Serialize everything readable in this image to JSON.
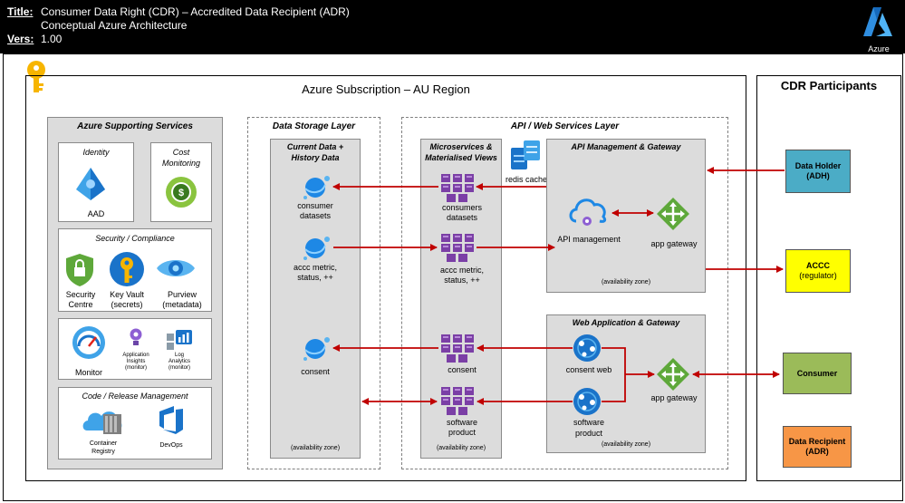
{
  "header": {
    "title_key": "Title:",
    "title_line1": "Consumer Data Right (CDR) – Accredited Data Recipient (ADR)",
    "title_line2": "Conceptual Azure Architecture",
    "vers_key": "Vers:",
    "version": "1.00",
    "logo_label": "Azure"
  },
  "subscription": {
    "title": "Azure Subscription – AU Region"
  },
  "participants": {
    "title": "CDR Participants",
    "data_holder": {
      "name": "Data Holder",
      "sub": "(ADH)",
      "color": "#4bacc6"
    },
    "accc": {
      "name": "ACCC",
      "sub": "(regulator)",
      "color": "#ffff00"
    },
    "consumer": {
      "name": "Consumer",
      "color": "#9bbb59"
    },
    "data_recipient": {
      "name": "Data Recipient",
      "sub": "(ADR)",
      "color": "#f79646"
    }
  },
  "supporting": {
    "title": "Azure Supporting Services",
    "identity": {
      "title": "Identity",
      "aad": "AAD"
    },
    "cost": {
      "title_line1": "Cost",
      "title_line2": "Monitoring"
    },
    "security": {
      "title": "Security / Compliance",
      "sec_centre_1": "Security",
      "sec_centre_2": "Centre",
      "keyvault_1": "Key Vault",
      "keyvault_2": "(secrets)",
      "purview_1": "Purview",
      "purview_2": "(metadata)"
    },
    "monitoring": {
      "monitor": "Monitor",
      "app_insights_1": "Application",
      "app_insights_2": "Insights",
      "app_insights_3": "(monitor)",
      "log_1": "Log",
      "log_2": "Analytics",
      "log_3": "(monitor)"
    },
    "code": {
      "title": "Code / Release Management",
      "registry_1": "Container",
      "registry_2": "Registry",
      "devops": "DevOps"
    }
  },
  "storage": {
    "title": "Data Storage Layer",
    "subtitle_1": "Current Data +",
    "subtitle_2": "History Data",
    "consumer_datasets_1": "consumer",
    "consumer_datasets_2": "datasets",
    "accc_metric_1": "accc metric,",
    "accc_metric_2": "status, ++",
    "consent": "consent",
    "zone": "(availability zone)"
  },
  "api_layer": {
    "title": "API / Web Services Layer",
    "micro_1": "Microservices &",
    "micro_2": "Materialised Views",
    "consumers_datasets_1": "consumers",
    "consumers_datasets_2": "datasets",
    "accc_metric_1": "accc metric,",
    "accc_metric_2": "status, ++",
    "consent": "consent",
    "software_product_1": "software",
    "software_product_2": "product",
    "micro_zone": "(availability zone)",
    "redis": "redis cache",
    "apim_gw_title": "API Management & Gateway",
    "api_management": "API management",
    "app_gateway": "app gateway",
    "apim_zone": "(availability zone)",
    "web_title": "Web Application & Gateway",
    "consent_web": "consent web",
    "software_product_web_1": "software",
    "software_product_web_2": "product",
    "web_app_gateway": "app gateway",
    "web_zone": "(availability zone)"
  },
  "colors": {
    "arrow": "#c00000",
    "cosmos": "#1e88e5",
    "microservice": "#7b3fa6",
    "key": "#f7b500"
  }
}
